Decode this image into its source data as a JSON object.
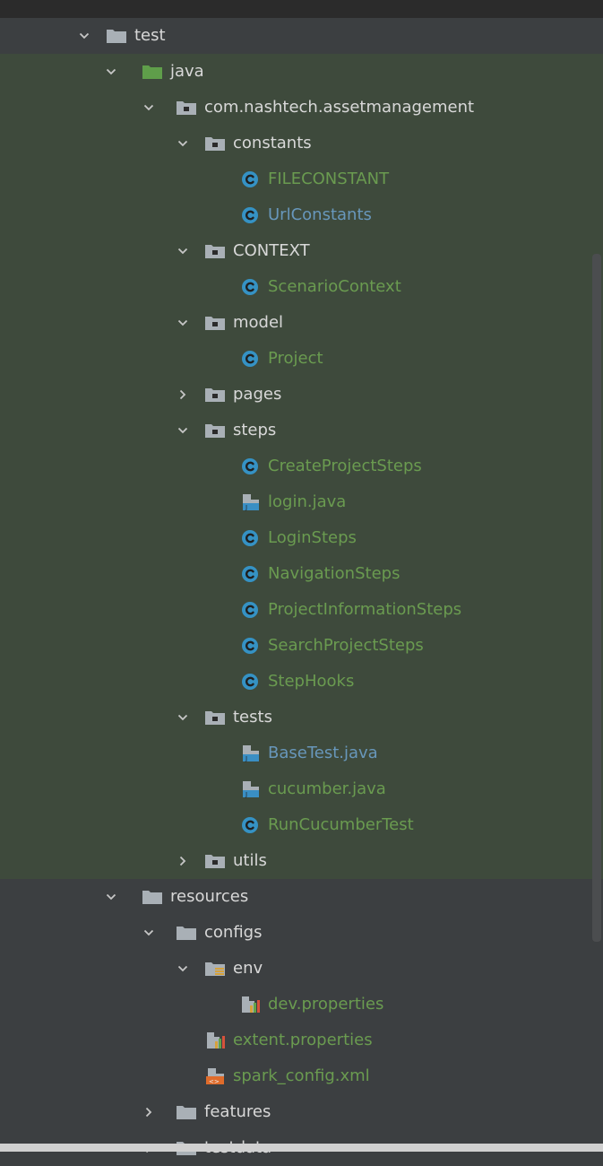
{
  "tree": [
    {
      "label": "test",
      "depth": 0,
      "expanded": true,
      "icon": "folder-icon",
      "color": "dir",
      "bg": "dark"
    },
    {
      "label": "java",
      "depth": 1,
      "expanded": true,
      "icon": "source-folder-icon",
      "color": "dir",
      "bg": "green"
    },
    {
      "label": "com.nashtech.assetmanagement",
      "depth": 2,
      "expanded": true,
      "icon": "package-icon",
      "color": "dir",
      "bg": "green"
    },
    {
      "label": "constants",
      "depth": 3,
      "expanded": true,
      "icon": "package-icon",
      "color": "dir",
      "bg": "green"
    },
    {
      "label": "FILECONSTANT",
      "depth": 4,
      "icon": "class-icon",
      "color": "green",
      "bg": "green"
    },
    {
      "label": "UrlConstants",
      "depth": 4,
      "icon": "class-icon",
      "color": "blue",
      "bg": "green"
    },
    {
      "label": "CONTEXT",
      "depth": 3,
      "expanded": true,
      "icon": "package-icon",
      "color": "dir",
      "bg": "green"
    },
    {
      "label": "ScenarioContext",
      "depth": 4,
      "icon": "class-icon",
      "color": "green",
      "bg": "green"
    },
    {
      "label": "model",
      "depth": 3,
      "expanded": true,
      "icon": "package-icon",
      "color": "dir",
      "bg": "green"
    },
    {
      "label": "Project",
      "depth": 4,
      "icon": "class-icon",
      "color": "green",
      "bg": "green"
    },
    {
      "label": "pages",
      "depth": 3,
      "expanded": false,
      "icon": "package-icon",
      "color": "dir",
      "bg": "green"
    },
    {
      "label": "steps",
      "depth": 3,
      "expanded": true,
      "icon": "package-icon",
      "color": "dir",
      "bg": "green"
    },
    {
      "label": "CreateProjectSteps",
      "depth": 4,
      "icon": "class-icon",
      "color": "green",
      "bg": "green"
    },
    {
      "label": "login.java",
      "depth": 4,
      "icon": "java-file-icon",
      "color": "green",
      "bg": "green"
    },
    {
      "label": "LoginSteps",
      "depth": 4,
      "icon": "class-icon",
      "color": "green",
      "bg": "green"
    },
    {
      "label": "NavigationSteps",
      "depth": 4,
      "icon": "class-icon",
      "color": "green",
      "bg": "green"
    },
    {
      "label": "ProjectInformationSteps",
      "depth": 4,
      "icon": "class-icon",
      "color": "green",
      "bg": "green"
    },
    {
      "label": "SearchProjectSteps",
      "depth": 4,
      "icon": "class-icon",
      "color": "green",
      "bg": "green"
    },
    {
      "label": "StepHooks",
      "depth": 4,
      "icon": "class-icon",
      "color": "green",
      "bg": "green"
    },
    {
      "label": "tests",
      "depth": 3,
      "expanded": true,
      "icon": "package-icon",
      "color": "dir",
      "bg": "green"
    },
    {
      "label": "BaseTest.java",
      "depth": 4,
      "icon": "java-file-icon",
      "color": "blue",
      "bg": "green"
    },
    {
      "label": "cucumber.java",
      "depth": 4,
      "icon": "java-file-icon",
      "color": "green",
      "bg": "green"
    },
    {
      "label": "RunCucumberTest",
      "depth": 4,
      "icon": "class-icon",
      "color": "green",
      "bg": "green"
    },
    {
      "label": "utils",
      "depth": 3,
      "expanded": false,
      "icon": "package-icon",
      "color": "dir",
      "bg": "green"
    },
    {
      "label": "resources",
      "depth": 1,
      "expanded": true,
      "icon": "folder-icon",
      "color": "dir",
      "bg": "dark"
    },
    {
      "label": "configs",
      "depth": 2,
      "expanded": true,
      "icon": "folder-icon",
      "color": "dir",
      "bg": "dark"
    },
    {
      "label": "env",
      "depth": 3,
      "expanded": true,
      "icon": "resource-folder-icon",
      "color": "dir",
      "bg": "dark"
    },
    {
      "label": "dev.properties",
      "depth": 4,
      "icon": "properties-file-icon",
      "color": "green",
      "bg": "dark"
    },
    {
      "label": "extent.properties",
      "depth": 3,
      "icon": "properties-file-icon",
      "color": "green",
      "bg": "dark"
    },
    {
      "label": "spark_config.xml",
      "depth": 3,
      "icon": "xml-file-icon",
      "color": "green",
      "bg": "dark"
    },
    {
      "label": "features",
      "depth": 2,
      "expanded": false,
      "icon": "folder-icon",
      "color": "dir",
      "bg": "dark"
    },
    {
      "label": "testdata",
      "depth": 2,
      "expanded": false,
      "icon": "folder-icon",
      "color": "dir",
      "bg": "dark"
    }
  ],
  "colors": {
    "dir": "#d8d8d8",
    "green": "#6a9b50",
    "blue": "#6897bb",
    "highlight_bg": "#3e4a3c",
    "panel_bg": "#3c3f41"
  }
}
